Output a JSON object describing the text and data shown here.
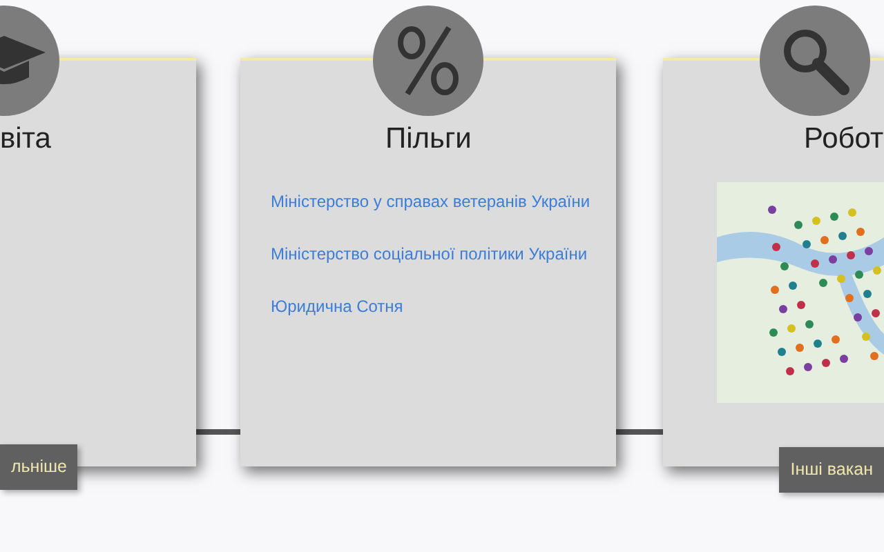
{
  "cards": [
    {
      "kind": "plain",
      "title": "віта",
      "button": "льніше"
    },
    {
      "kind": "links",
      "title": "Пільги",
      "links": [
        "Міністерство у справах ветеранів України",
        "Міністерство соціальної політики України",
        "Юридична Сотня"
      ]
    },
    {
      "kind": "map",
      "title": "Робот",
      "button": "Інші вакан"
    }
  ]
}
